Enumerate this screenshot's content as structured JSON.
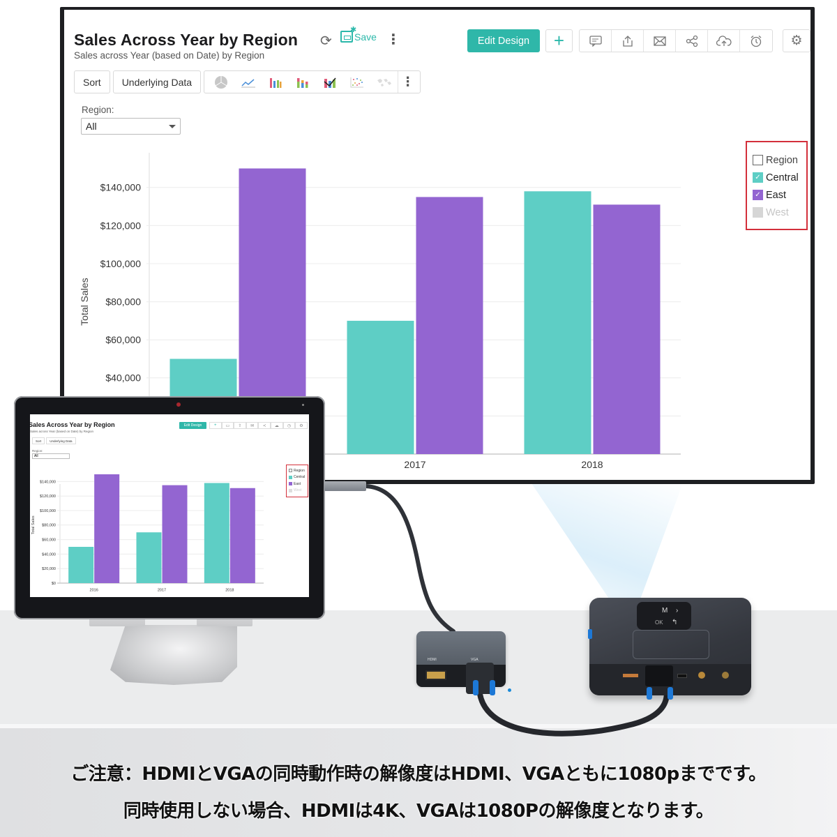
{
  "dashboard": {
    "title": "Sales Across Year by Region",
    "subtitle": "Sales across Year (based on Date) by Region",
    "save_label": "Save",
    "edit_design_label": "Edit Design",
    "toolbar": {
      "sort_label": "Sort",
      "underlying_data_label": "Underlying Data"
    },
    "chart_type_icons": [
      "pie-chart-icon",
      "line-chart-icon",
      "bar-chart-icon",
      "stacked-bar-icon",
      "combo-chart-icon",
      "scatter-chart-icon",
      "map-chart-icon"
    ],
    "action_icons": [
      "comment-icon",
      "export-icon",
      "email-icon",
      "share-icon",
      "publish-cloud-icon",
      "schedule-alarm-icon"
    ],
    "filter": {
      "label": "Region:",
      "selected": "All"
    },
    "legend": {
      "header": "Region",
      "items": [
        {
          "label": "Central",
          "checked": true,
          "color": "#5ecec5"
        },
        {
          "label": "East",
          "checked": true,
          "color": "#9365d1"
        },
        {
          "label": "West",
          "checked": false,
          "color": "#cccccc"
        }
      ]
    }
  },
  "colors": {
    "accent": "#2fb7a9",
    "central": "#5ecec5",
    "east": "#9365d1",
    "legend_border": "#d32f3a"
  },
  "chart_data": {
    "type": "bar",
    "title": "Sales Across Year by Region",
    "subtitle": "Sales across Year (based on Date) by Region",
    "xlabel": "",
    "ylabel": "Total Sales",
    "categories": [
      "2016",
      "2017",
      "2018"
    ],
    "series": [
      {
        "name": "Central",
        "values": [
          50000,
          70000,
          138000
        ]
      },
      {
        "name": "East",
        "values": [
          150000,
          135000,
          131000
        ]
      }
    ],
    "ylim": [
      0,
      160000
    ],
    "yticks": [
      0,
      20000,
      40000,
      60000,
      80000,
      100000,
      120000,
      140000
    ],
    "ytick_labels": [
      "$0",
      "$20,000",
      "$40,000",
      "$60,000",
      "$80,000",
      "$100,000",
      "$120,000",
      "$140,000"
    ],
    "grid": true,
    "legend_position": "right",
    "legend_title": "Region"
  },
  "caption": {
    "line1": "ご注意：HDMIとVGAの同時動作時の解像度はHDMI、VGAともに1080pまでです。",
    "line2": "同時使用しない場合、HDMIは4K、VGAは1080Pの解像度となります。"
  },
  "adapter": {
    "port_labels": [
      "HDMI",
      "VGA"
    ]
  },
  "projector": {
    "button_labels": [
      "M",
      "OK"
    ]
  }
}
